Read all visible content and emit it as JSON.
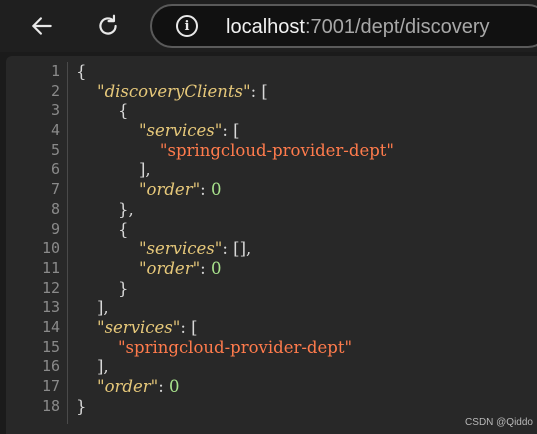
{
  "browser": {
    "url_host": "localhost",
    "url_rest": ":7001/dept/discovery"
  },
  "colors": {
    "background": "#282828",
    "key": "#e6c87a",
    "string": "#ff7b4c",
    "number": "#a8e28c",
    "punctuation": "#d8d8d8",
    "line_number": "#8a8a8a"
  },
  "icons": {
    "back": "arrow-left-icon",
    "reload": "reload-icon",
    "info": "info-circle-icon"
  },
  "lines": [
    {
      "num": "1",
      "tokens": [
        {
          "t": "p",
          "v": "{"
        }
      ]
    },
    {
      "num": "2",
      "tokens": [
        {
          "t": "p",
          "v": "    "
        },
        {
          "t": "k",
          "v": "\"discoveryClients\""
        },
        {
          "t": "p",
          "v": ": ["
        }
      ]
    },
    {
      "num": "3",
      "tokens": [
        {
          "t": "p",
          "v": "        {"
        }
      ]
    },
    {
      "num": "4",
      "tokens": [
        {
          "t": "p",
          "v": "            "
        },
        {
          "t": "k",
          "v": "\"services\""
        },
        {
          "t": "p",
          "v": ": ["
        }
      ]
    },
    {
      "num": "5",
      "tokens": [
        {
          "t": "p",
          "v": "                "
        },
        {
          "t": "s",
          "v": "\"springcloud-provider-dept\""
        }
      ]
    },
    {
      "num": "6",
      "tokens": [
        {
          "t": "p",
          "v": "            ],"
        }
      ]
    },
    {
      "num": "7",
      "tokens": [
        {
          "t": "p",
          "v": "            "
        },
        {
          "t": "k",
          "v": "\"order\""
        },
        {
          "t": "p",
          "v": ": "
        },
        {
          "t": "n",
          "v": "0"
        }
      ]
    },
    {
      "num": "8",
      "tokens": [
        {
          "t": "p",
          "v": "        },"
        }
      ]
    },
    {
      "num": "9",
      "tokens": [
        {
          "t": "p",
          "v": "        {"
        }
      ]
    },
    {
      "num": "10",
      "tokens": [
        {
          "t": "p",
          "v": "            "
        },
        {
          "t": "k",
          "v": "\"services\""
        },
        {
          "t": "p",
          "v": ": [],"
        }
      ]
    },
    {
      "num": "11",
      "tokens": [
        {
          "t": "p",
          "v": "            "
        },
        {
          "t": "k",
          "v": "\"order\""
        },
        {
          "t": "p",
          "v": ": "
        },
        {
          "t": "n",
          "v": "0"
        }
      ]
    },
    {
      "num": "12",
      "tokens": [
        {
          "t": "p",
          "v": "        }"
        }
      ]
    },
    {
      "num": "13",
      "tokens": [
        {
          "t": "p",
          "v": "    ],"
        }
      ]
    },
    {
      "num": "14",
      "tokens": [
        {
          "t": "p",
          "v": "    "
        },
        {
          "t": "k",
          "v": "\"services\""
        },
        {
          "t": "p",
          "v": ": ["
        }
      ]
    },
    {
      "num": "15",
      "tokens": [
        {
          "t": "p",
          "v": "        "
        },
        {
          "t": "s",
          "v": "\"springcloud-provider-dept\""
        }
      ]
    },
    {
      "num": "16",
      "tokens": [
        {
          "t": "p",
          "v": "    ],"
        }
      ]
    },
    {
      "num": "17",
      "tokens": [
        {
          "t": "p",
          "v": "    "
        },
        {
          "t": "k",
          "v": "\"order\""
        },
        {
          "t": "p",
          "v": ": "
        },
        {
          "t": "n",
          "v": "0"
        }
      ]
    },
    {
      "num": "18",
      "tokens": [
        {
          "t": "p",
          "v": "}"
        }
      ]
    }
  ],
  "watermark": "CSDN @Qiddo"
}
